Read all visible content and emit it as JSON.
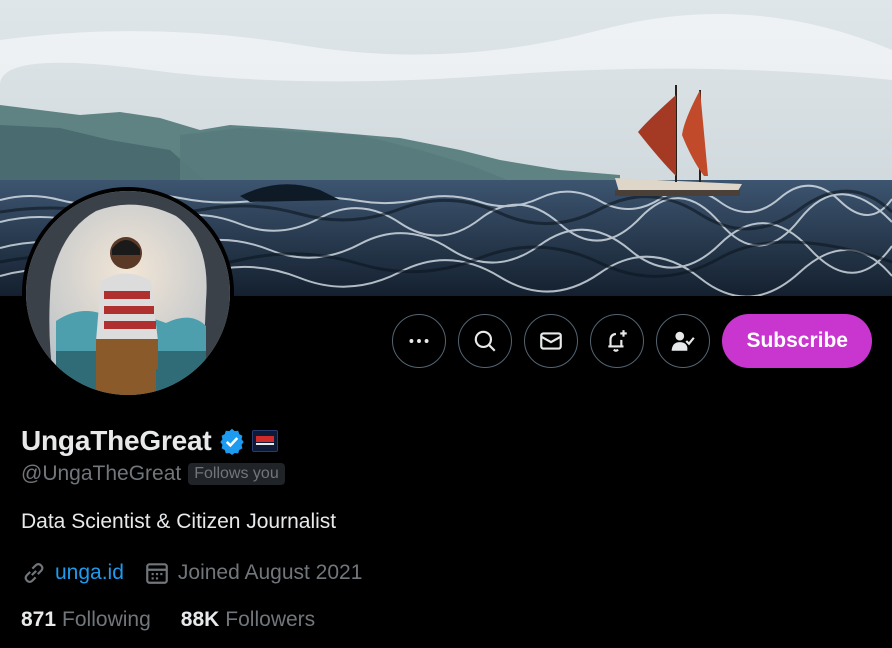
{
  "profile": {
    "display_name": "UngaTheGreat",
    "handle": "@UngaTheGreat",
    "follows_you_badge": "Follows you",
    "bio": "Data Scientist & Citizen Journalist",
    "website": "unga.id",
    "joined": "Joined August 2021",
    "following_count": "871",
    "following_label": "Following",
    "followers_count": "88K",
    "followers_label": "Followers",
    "verified": true
  },
  "actions": {
    "more_icon": "more-horizontal-icon",
    "search_icon": "search-icon",
    "message_icon": "envelope-icon",
    "notify_icon": "bell-plus-icon",
    "following_icon": "person-check-icon",
    "subscribe_label": "Subscribe"
  },
  "colors": {
    "background": "#000000",
    "subscribe": "#c936cf",
    "link": "#1d9bf0",
    "verified": "#1d9bf0",
    "muted_text": "#71767b",
    "primary_text": "#e7e9ea",
    "button_border": "#536471"
  }
}
